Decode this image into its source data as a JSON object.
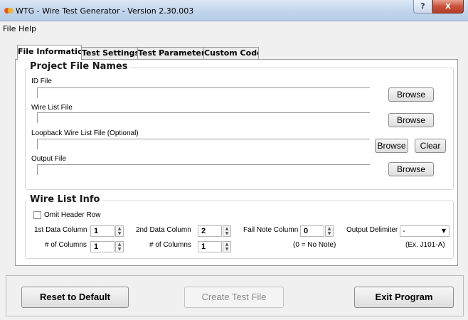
{
  "window": {
    "title": "WTG - Wire Test Generator - Version 2.30.003",
    "help_glyph": "?",
    "close_glyph": "x"
  },
  "menu": {
    "items": [
      "File",
      "Help"
    ]
  },
  "tabs": [
    "File Information",
    "Test Settings",
    "Test Parameters",
    "Custom Code"
  ],
  "project_files": {
    "legend": "Project File Names",
    "id_file_label": "ID File",
    "wire_list_label": "Wire List File",
    "loopback_label": "Loopback Wire List File (Optional)",
    "output_label": "Output File",
    "browse_label": "Browse",
    "clear_label": "Clear"
  },
  "wire_list_info": {
    "legend": "Wire List Info",
    "omit_header_label": "Omit Header Row",
    "data1_label": "1st Data Column",
    "data1_value": "1",
    "cols1_label": "# of Columns",
    "cols1_value": "1",
    "data2_label": "2nd Data Column",
    "data2_value": "2",
    "cols2_label": "# of Columns",
    "cols2_value": "1",
    "fail_note_label": "Fail Note Column",
    "fail_note_value": "0",
    "fail_note_hint": "(0 = No Note)",
    "delimiter_label": "Output Delimiter",
    "delimiter_value": "-",
    "delimiter_hint": "(Ex. J101-A)"
  },
  "actions": {
    "reset": "Reset to Default",
    "create": "Create Test File",
    "exit": "Exit Program"
  },
  "colors": {
    "title_gradient": "#c2d5ec",
    "close_red": "#c9523b",
    "disabled_text": "#8a8a8a"
  },
  "icons": {
    "app": "wtg-app-icon",
    "spin_up": "spin-up-arrow-icon",
    "spin_down": "spin-down-arrow-icon",
    "dropdown": "chevron-down-icon"
  }
}
